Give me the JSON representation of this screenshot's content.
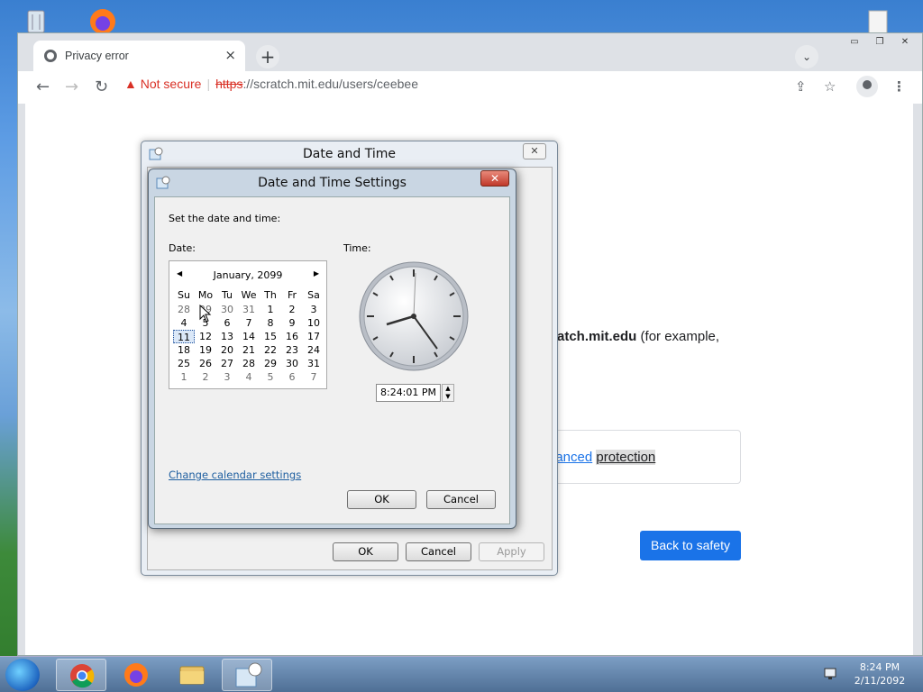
{
  "browser": {
    "tab_title": "Privacy error",
    "tab_close": "×",
    "new_tab": "+",
    "tab_search": "⌄",
    "window_buttons": {
      "minimize": "▭",
      "restore": "❐",
      "close": "✕"
    },
    "nav": {
      "back": "←",
      "forward": "→",
      "reload": "↻"
    },
    "address": {
      "warning_icon": "▲",
      "security_label": "Not secure",
      "separator": "|",
      "scheme": "https",
      "rest": "://scratch.mit.edu/users/ceebee"
    },
    "toolbar_icons": {
      "share": "⇪",
      "bookmark": "☆",
      "menu": "⋮"
    },
    "page": {
      "domain_bold": "atch.mit.edu",
      "domain_suffix": " (for example,",
      "protection_link": "nanced",
      "protection_highlight": "protection",
      "back_button": "Back to safety"
    }
  },
  "outer_dialog": {
    "title": "Date and Time",
    "close": "✕",
    "ok": "OK",
    "cancel": "Cancel",
    "apply": "Apply"
  },
  "dialog": {
    "title": "Date and Time Settings",
    "close": "✕",
    "instruction": "Set the date and time:",
    "date_label": "Date:",
    "time_label": "Time:",
    "calendar": {
      "month_year": "January, 2099",
      "prev": "◀",
      "next": "▶",
      "weekdays": [
        "Su",
        "Mo",
        "Tu",
        "We",
        "Th",
        "Fr",
        "Sa"
      ],
      "weeks": [
        [
          "28",
          "29",
          "30",
          "31",
          "1",
          "2",
          "3"
        ],
        [
          "4",
          "5",
          "6",
          "7",
          "8",
          "9",
          "10"
        ],
        [
          "11",
          "12",
          "13",
          "14",
          "15",
          "16",
          "17"
        ],
        [
          "18",
          "19",
          "20",
          "21",
          "22",
          "23",
          "24"
        ],
        [
          "25",
          "26",
          "27",
          "28",
          "29",
          "30",
          "31"
        ],
        [
          "1",
          "2",
          "3",
          "4",
          "5",
          "6",
          "7"
        ]
      ],
      "selected": "11"
    },
    "time_value": "8:24:01 PM",
    "spin_up": "▲",
    "spin_down": "▼",
    "change_calendar": "Change calendar settings",
    "ok": "OK",
    "cancel": "Cancel"
  },
  "taskbar": {
    "time": "8:24 PM",
    "date": "2/11/2092"
  }
}
